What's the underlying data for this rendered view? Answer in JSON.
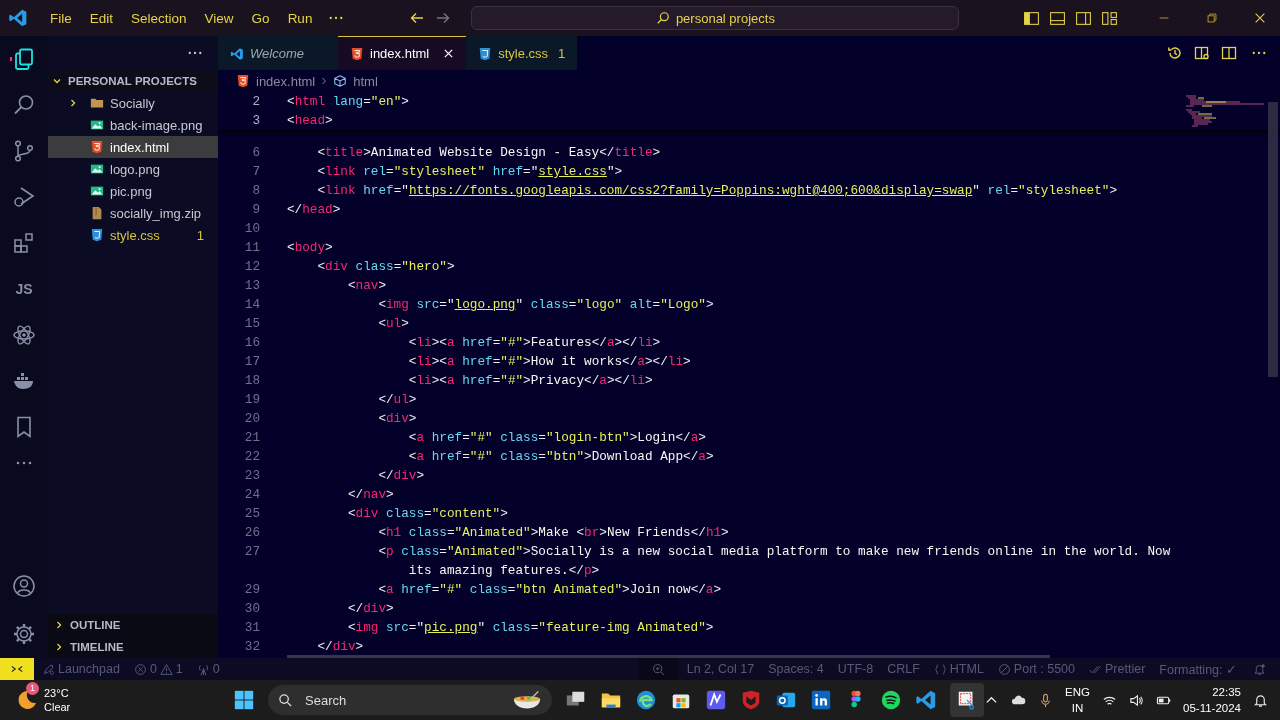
{
  "menu": [
    "File",
    "Edit",
    "Selection",
    "View",
    "Go",
    "Run"
  ],
  "command_center": "personal projects",
  "activity_label": "JS",
  "sidebar": {
    "title": "PERSONAL PROJECTS",
    "items": [
      {
        "label": "Socially",
        "kind": "folder",
        "selected": false
      },
      {
        "label": "back-image.png",
        "kind": "image",
        "selected": false
      },
      {
        "label": "index.html",
        "kind": "html",
        "selected": true
      },
      {
        "label": "logo.png",
        "kind": "image",
        "selected": false
      },
      {
        "label": "pic.png",
        "kind": "image",
        "selected": false
      },
      {
        "label": "socially_img.zip",
        "kind": "zip",
        "selected": false
      },
      {
        "label": "style.css",
        "kind": "css",
        "selected": false,
        "problems": "1"
      }
    ],
    "panels": [
      "OUTLINE",
      "TIMELINE"
    ]
  },
  "tabs": [
    {
      "label": "Welcome",
      "kind": "welcome",
      "selected": false,
      "preview": true
    },
    {
      "label": "index.html",
      "kind": "html",
      "selected": true,
      "preview": false
    },
    {
      "label": "style.css",
      "kind": "css",
      "selected": false,
      "preview": false,
      "problems": "1"
    }
  ],
  "breadcrumb": [
    "index.html",
    "html"
  ],
  "sticky": [
    {
      "n": "2",
      "text": "<html lang=\"en\">"
    },
    {
      "n": "3",
      "text": "<head>"
    }
  ],
  "code": [
    {
      "n": "6",
      "text": "    <title>Animated Website Design - Easy</title>"
    },
    {
      "n": "7",
      "text": "    <link rel=\"stylesheet\" href=\"style.css\">"
    },
    {
      "n": "8",
      "text": "    <link href=\"https://fonts.googleapis.com/css2?family=Poppins:wght@400;600&display=swap\" rel=\"stylesheet\">"
    },
    {
      "n": "9",
      "text": "</head>"
    },
    {
      "n": "10"
    },
    {
      "n": "11",
      "text": "<body>"
    },
    {
      "n": "12",
      "text": "    <div class=\"hero\">"
    },
    {
      "n": "13",
      "text": "        <nav>"
    },
    {
      "n": "14",
      "text": "            <img src=\"logo.png\" class=\"logo\" alt=\"Logo\">"
    },
    {
      "n": "15",
      "text": "            <ul>"
    },
    {
      "n": "16",
      "text": "                <li><a href=\"#\">Features</a></li>"
    },
    {
      "n": "17",
      "text": "                <li><a href=\"#\">How it works</a></li>"
    },
    {
      "n": "18",
      "text": "                <li><a href=\"#\">Privacy</a></li>"
    },
    {
      "n": "19",
      "text": "            </ul>"
    },
    {
      "n": "20",
      "text": "            <div>"
    },
    {
      "n": "21",
      "text": "                <a href=\"#\" class=\"login-btn\">Login</a>"
    },
    {
      "n": "22",
      "text": "                <a href=\"#\" class=\"btn\">Download App</a>"
    },
    {
      "n": "23",
      "text": "            </div>"
    },
    {
      "n": "24",
      "text": "        </nav>"
    },
    {
      "n": "25",
      "text": "        <div class=\"content\">"
    },
    {
      "n": "26",
      "text": "            <h1 class=\"Animated\">Make <br>New Friends</h1>"
    },
    {
      "n": "27",
      "text": "            <p class=\"Animated\">Socially is a new social media platform to make new friends online in the world. Now",
      "wrap": "                its amazing features.</p>"
    },
    {
      "n": "29",
      "text": "            <a href=\"#\" class=\"btn Animated\">Join now</a>"
    },
    {
      "n": "30",
      "text": "        </div>"
    },
    {
      "n": "31",
      "text": "        <img src=\"pic.png\" class=\"feature-img Animated\">"
    },
    {
      "n": "32",
      "text": "    </div>"
    }
  ],
  "status_bar": {
    "launchpad": "Launchpad",
    "errors": "0",
    "warnings": "1",
    "ports": "0",
    "cursor": "Ln 2, Col 17",
    "indent": "Spaces: 4",
    "encoding": "UTF-8",
    "eol": "CRLF",
    "language": "HTML",
    "live_server": "Port : 5500",
    "formatter": "Prettier",
    "formatting": "Formatting: ✓"
  },
  "taskbar": {
    "weather_badge": "1",
    "temperature": "23°C",
    "condition": "Clear",
    "search": "Search",
    "language": "ENG",
    "region": "IN",
    "time": "22:35",
    "date": "05-11-2024"
  }
}
